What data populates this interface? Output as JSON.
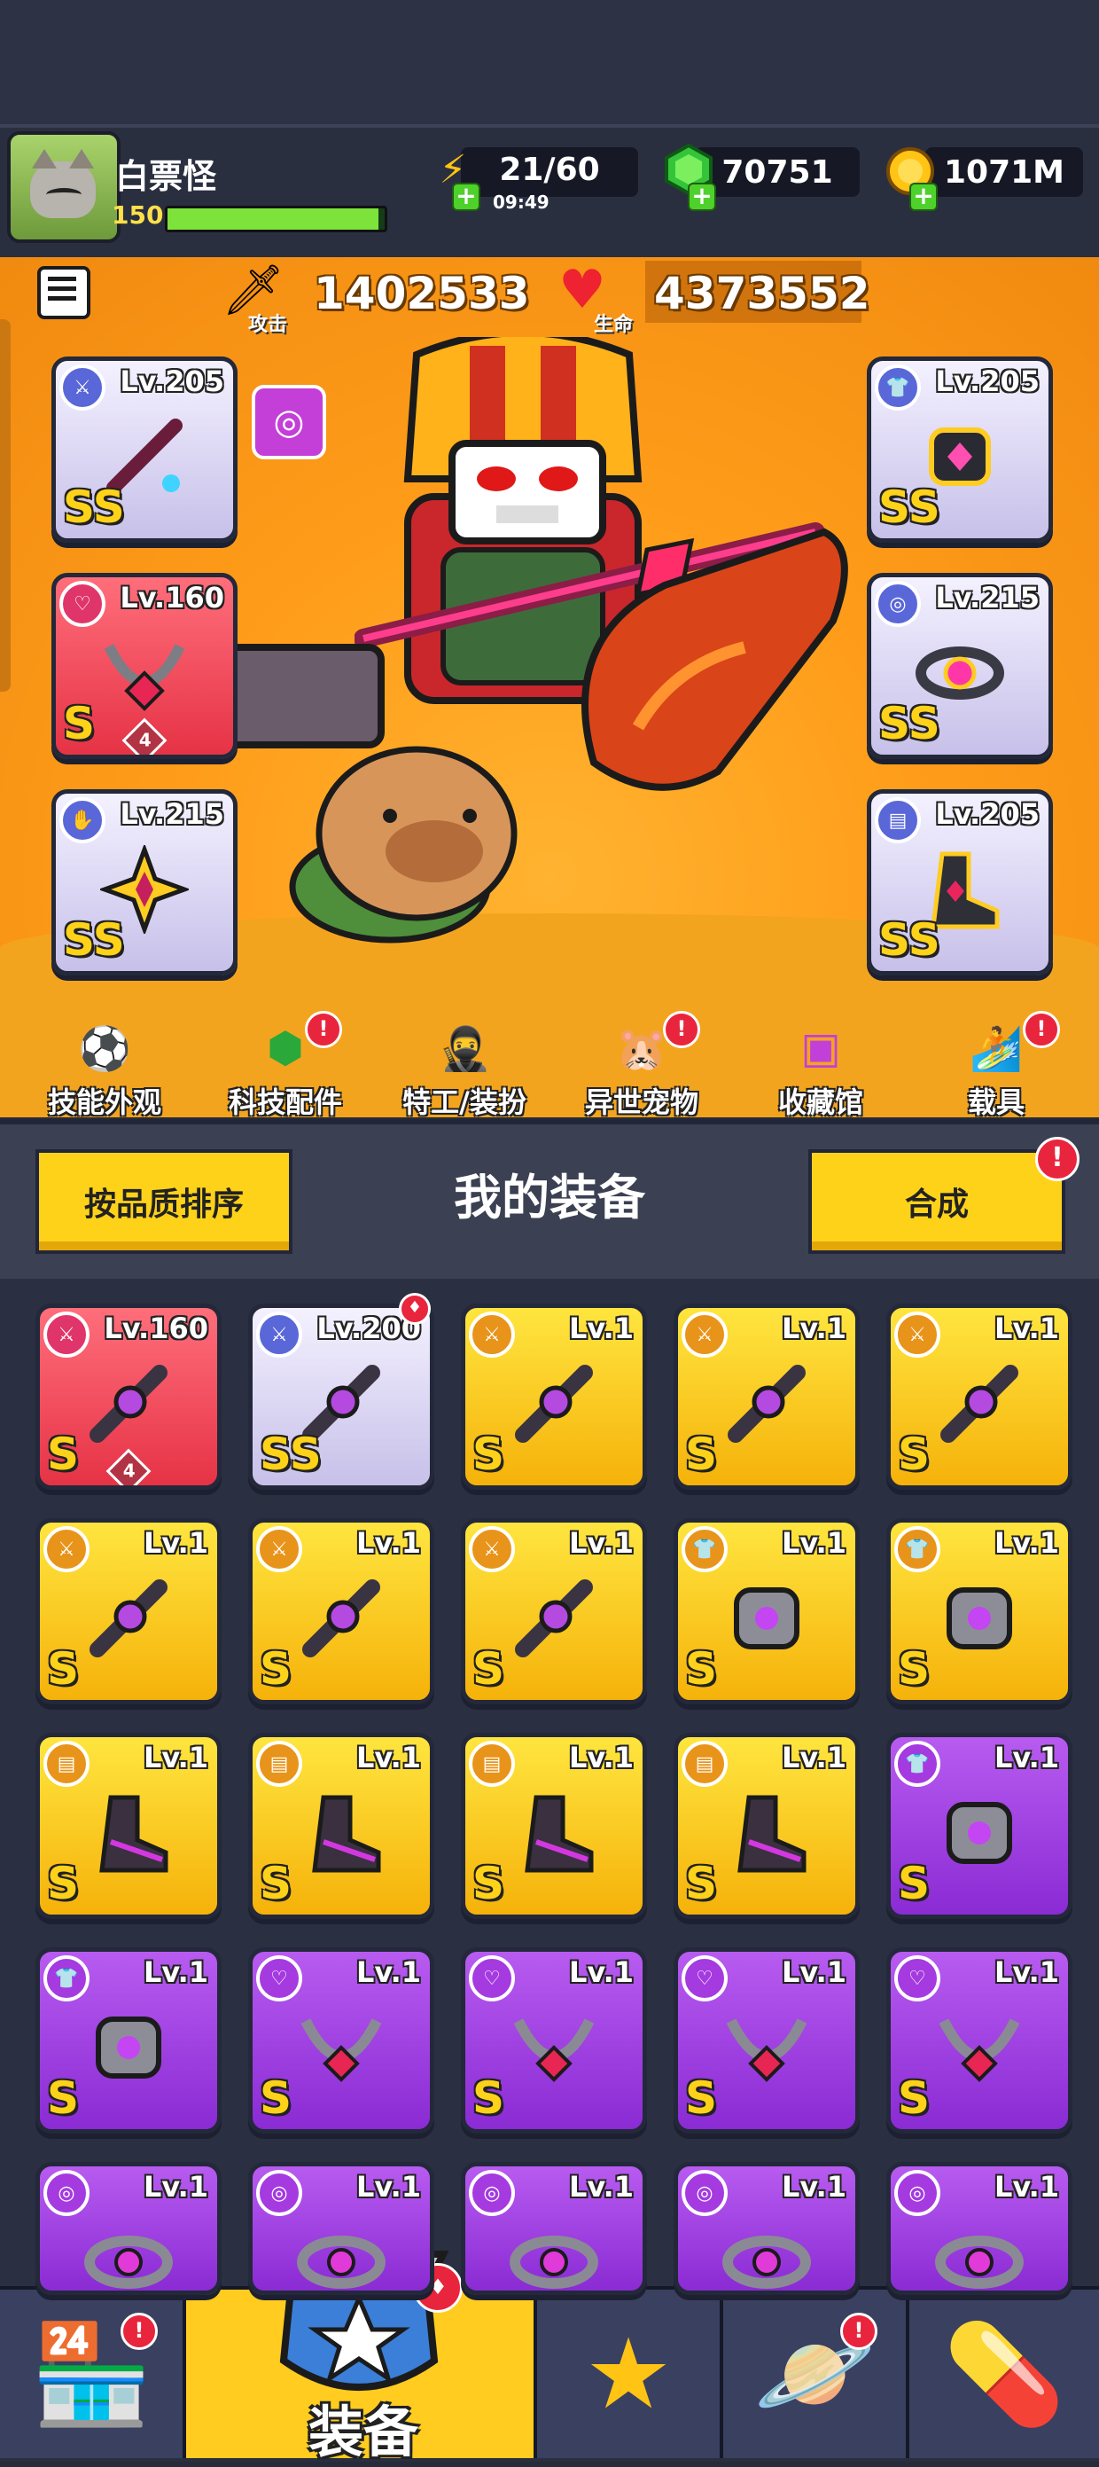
{
  "player": {
    "name": "白票怪",
    "level": "150",
    "xp_fraction": 0.97
  },
  "resources": [
    {
      "id": "energy",
      "value": "21/60",
      "timer": "09:49",
      "icon": "lightning-icon"
    },
    {
      "id": "gems",
      "value": "70751",
      "icon": "green-gem-icon"
    },
    {
      "id": "coins",
      "value": "1071M",
      "icon": "gold-coin-icon"
    }
  ],
  "stats": {
    "attack_label": "攻击",
    "attack_value": "1402533",
    "hp_label": "生命",
    "hp_value": "4373552"
  },
  "equipped": [
    {
      "slot": "weapon",
      "level": "Lv.205",
      "grade": "SS",
      "quality": "white"
    },
    {
      "slot": "necklace",
      "level": "Lv.160",
      "grade": "S",
      "quality": "red",
      "stars": "4"
    },
    {
      "slot": "gloves",
      "level": "Lv.215",
      "grade": "SS",
      "quality": "white"
    },
    {
      "slot": "armor",
      "level": "Lv.205",
      "grade": "SS",
      "quality": "white"
    },
    {
      "slot": "belt",
      "level": "Lv.215",
      "grade": "SS",
      "quality": "white"
    },
    {
      "slot": "boots",
      "level": "Lv.205",
      "grade": "SS",
      "quality": "white"
    }
  ],
  "submenu": [
    {
      "label": "技能外观",
      "badge": false
    },
    {
      "label": "科技配件",
      "badge": true
    },
    {
      "label": "特工/装扮",
      "badge": false
    },
    {
      "label": "异世宠物",
      "badge": true
    },
    {
      "label": "收藏馆",
      "badge": false
    },
    {
      "label": "载具",
      "badge": true
    }
  ],
  "equipment_panel": {
    "sort_label": "按品质排序",
    "title": "我的装备",
    "merge_label": "合成",
    "merge_badge": "!"
  },
  "inventory": [
    {
      "level": "Lv.160",
      "grade": "S",
      "quality": "red",
      "stars": "4"
    },
    {
      "level": "Lv.200",
      "grade": "SS",
      "quality": "white"
    },
    {
      "level": "Lv.1",
      "grade": "S",
      "quality": "gold"
    },
    {
      "level": "Lv.1",
      "grade": "S",
      "quality": "gold"
    },
    {
      "level": "Lv.1",
      "grade": "S",
      "quality": "gold"
    },
    {
      "level": "Lv.1",
      "grade": "S",
      "quality": "gold"
    },
    {
      "level": "Lv.1",
      "grade": "S",
      "quality": "gold"
    },
    {
      "level": "Lv.1",
      "grade": "S",
      "quality": "gold"
    },
    {
      "level": "Lv.1",
      "grade": "S",
      "quality": "gold"
    },
    {
      "level": "Lv.1",
      "grade": "S",
      "quality": "gold"
    },
    {
      "level": "Lv.1",
      "grade": "S",
      "quality": "gold"
    },
    {
      "level": "Lv.1",
      "grade": "S",
      "quality": "gold"
    },
    {
      "level": "Lv.1",
      "grade": "S",
      "quality": "gold"
    },
    {
      "level": "Lv.1",
      "grade": "S",
      "quality": "gold"
    },
    {
      "level": "Lv.1",
      "grade": "S",
      "quality": "purple"
    },
    {
      "level": "Lv.1",
      "grade": "S",
      "quality": "purple"
    },
    {
      "level": "Lv.1",
      "grade": "S",
      "quality": "purple"
    },
    {
      "level": "Lv.1",
      "grade": "S",
      "quality": "purple"
    },
    {
      "level": "Lv.1",
      "grade": "S",
      "quality": "purple"
    },
    {
      "level": "Lv.1",
      "grade": "S",
      "quality": "purple"
    },
    {
      "level": "Lv.1",
      "grade": "",
      "quality": "purple"
    },
    {
      "level": "Lv.1",
      "grade": "",
      "quality": "purple"
    },
    {
      "level": "Lv.1",
      "grade": "",
      "quality": "purple"
    },
    {
      "level": "Lv.1",
      "grade": "",
      "quality": "purple"
    },
    {
      "level": "Lv.1",
      "grade": "",
      "quality": "purple"
    }
  ],
  "bottom_nav": [
    {
      "id": "shop",
      "icon": "shop-icon",
      "badge": true
    },
    {
      "id": "equipment",
      "label": "装备",
      "icon": "equipment-icon",
      "active": true
    },
    {
      "id": "battle",
      "icon": "star-swords-icon"
    },
    {
      "id": "world",
      "icon": "planet-icon",
      "badge": true
    },
    {
      "id": "lab",
      "icon": "dna-capsule-icon"
    }
  ],
  "colors": {
    "accent_gold": "#ffd21a",
    "badge_red": "#e8253c",
    "hero_bg": "#ff9d1a"
  }
}
